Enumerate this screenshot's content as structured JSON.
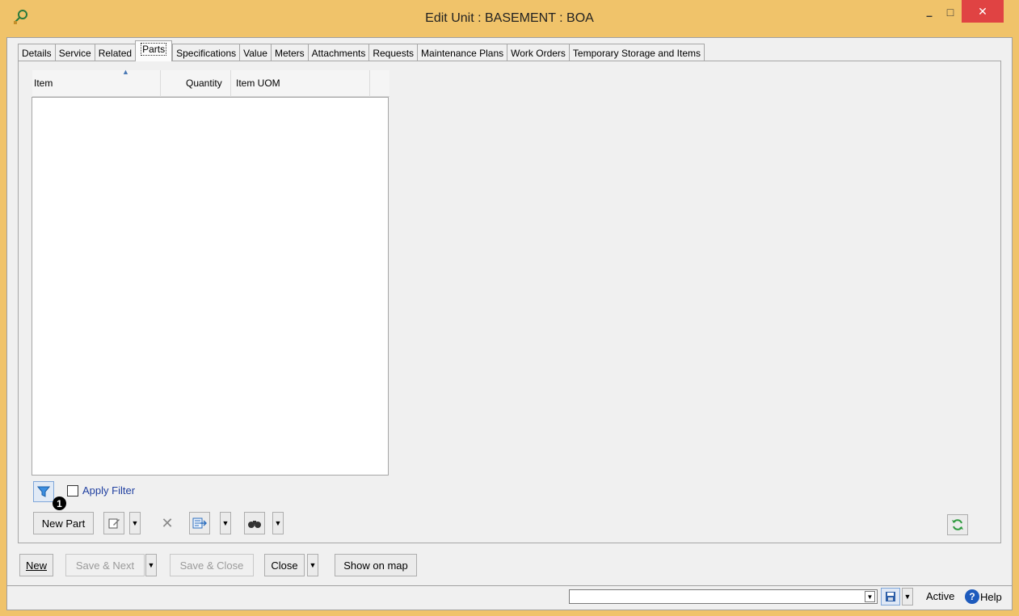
{
  "window": {
    "title": "Edit Unit : BASEMENT : BOA",
    "minimize_glyph": "–",
    "maximize_glyph": "□",
    "close_glyph": "✕"
  },
  "tabs": [
    {
      "label": "Details"
    },
    {
      "label": "Service"
    },
    {
      "label": "Related"
    },
    {
      "label": "Parts",
      "active": true
    },
    {
      "label": "Specifications"
    },
    {
      "label": "Value"
    },
    {
      "label": "Meters"
    },
    {
      "label": "Attachments"
    },
    {
      "label": "Requests"
    },
    {
      "label": "Maintenance Plans"
    },
    {
      "label": "Work Orders"
    },
    {
      "label": "Temporary Storage and Items"
    }
  ],
  "grid": {
    "columns": {
      "item": "Item",
      "quantity": "Quantity",
      "uom": "Item UOM"
    },
    "rows": []
  },
  "filter": {
    "label": "Apply Filter",
    "checked": false
  },
  "callout_badge": "1",
  "toolbar": {
    "new_part_label": "New Part"
  },
  "footer": {
    "new_label": "New",
    "save_next_label": "Save & Next",
    "save_close_label": "Save & Close",
    "close_label": "Close",
    "show_on_map_label": "Show on map"
  },
  "statusbar": {
    "search_value": "",
    "status_text": "Active",
    "help_label": "Help"
  },
  "icons": {
    "app": "app-icon",
    "filter": "filter-funnel-icon",
    "edit": "edit-icon",
    "delete": "delete-x-icon",
    "export": "export-icon",
    "find": "binoculars-icon",
    "refresh": "refresh-icon",
    "save": "save-disk-icon",
    "help": "help-icon"
  },
  "colors": {
    "titlebar": "#f0c36a",
    "close_button": "#e04343",
    "link_blue": "#1f3fa0",
    "accent_blue": "#1e5bbd"
  }
}
